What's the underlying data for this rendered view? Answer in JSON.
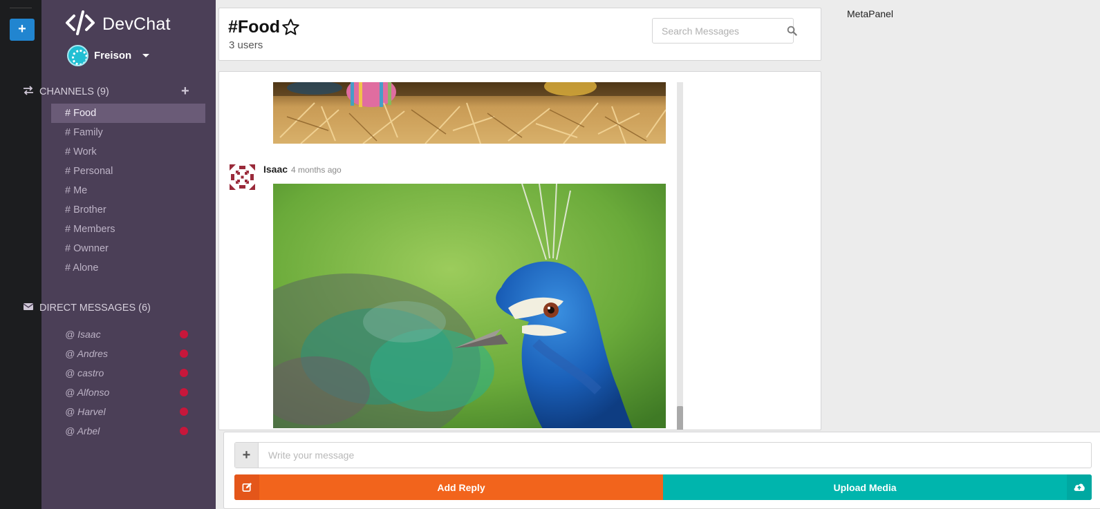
{
  "app": {
    "name": "DevChat"
  },
  "user": {
    "name": "Freison"
  },
  "channels": {
    "header": "CHANNELS (9)",
    "items": [
      {
        "label": "# Food",
        "active": true
      },
      {
        "label": "# Family"
      },
      {
        "label": "# Work"
      },
      {
        "label": "# Personal"
      },
      {
        "label": "# Me"
      },
      {
        "label": "# Brother"
      },
      {
        "label": "# Members"
      },
      {
        "label": "# Ownner"
      },
      {
        "label": "# Alone"
      }
    ]
  },
  "direct_messages": {
    "header": "DIRECT MESSAGES (6)",
    "items": [
      {
        "label": "@ Isaac",
        "status": "offline"
      },
      {
        "label": "@ Andres",
        "status": "offline"
      },
      {
        "label": "@ castro",
        "status": "offline"
      },
      {
        "label": "@ Alfonso",
        "status": "offline"
      },
      {
        "label": "@ Harvel",
        "status": "offline"
      },
      {
        "label": "@ Arbel",
        "status": "offline"
      }
    ]
  },
  "channel_header": {
    "title": "#Food",
    "users": "3 users",
    "search_placeholder": "Search Messages"
  },
  "messages": [
    {
      "author": "Isaac",
      "time": "4 months ago",
      "attachment": "peacock-photo"
    }
  ],
  "metapanel": {
    "title": "MetaPanel"
  },
  "composer": {
    "placeholder": "Write your message",
    "add_reply": "Add Reply",
    "upload_media": "Upload Media"
  },
  "colors": {
    "sidebar": "#4b3f57",
    "rail": "#1c1d1f",
    "add_reply": "#f2641c",
    "upload_media": "#00b5ad",
    "online_dot": "#c7173b"
  }
}
